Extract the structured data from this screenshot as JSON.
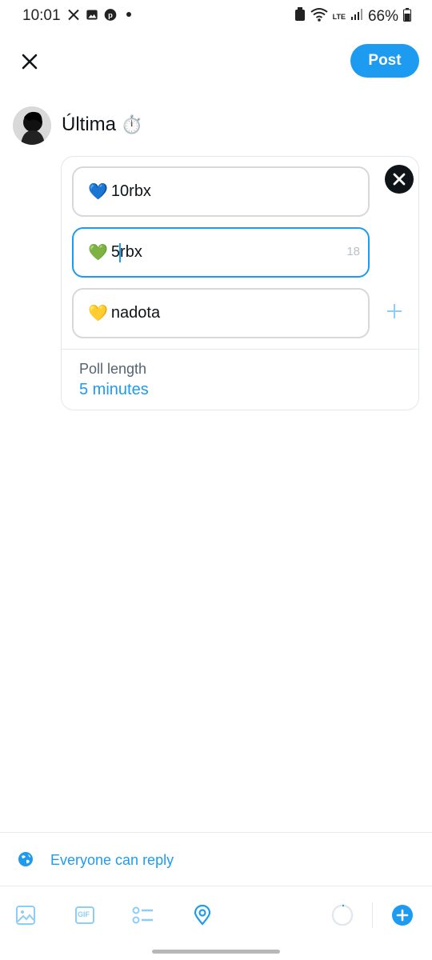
{
  "status_bar": {
    "time": "10:01",
    "battery": "66%",
    "network_label": "LTE"
  },
  "header": {
    "post_label": "Post"
  },
  "composer": {
    "text": "Última",
    "emoji": "⏱️"
  },
  "poll": {
    "options": [
      {
        "emoji": "💙",
        "text": "10rbx"
      },
      {
        "emoji": "💚",
        "text_before_caret": "5",
        "text_after_caret": "rbx",
        "counter": "18"
      },
      {
        "emoji": "💛",
        "text": "nadota"
      }
    ],
    "length_label": "Poll length",
    "length_value": "5 minutes"
  },
  "reply_setting": {
    "label": "Everyone can reply"
  },
  "toolbar": {
    "items": [
      "image-icon",
      "gif-icon",
      "poll-icon",
      "location-icon",
      "character-counter",
      "add-post-icon"
    ],
    "gif_label": "GIF"
  },
  "colors": {
    "accent": "#1d9bf0",
    "text": "#0f1419",
    "muted": "#536471",
    "border": "#e1e8ed"
  }
}
